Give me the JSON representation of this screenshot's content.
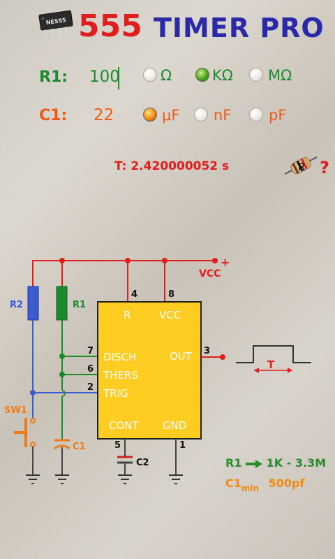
{
  "header": {
    "chip_label": "NE555",
    "title_number": "555",
    "title_text": "TIMER PRO"
  },
  "r1": {
    "label": "R1:",
    "value": "100",
    "units": [
      "Ω",
      "KΩ",
      "MΩ"
    ],
    "selected_unit": "KΩ"
  },
  "c1": {
    "label": "C1:",
    "value": "22",
    "units": [
      "μF",
      "nF",
      "pF"
    ],
    "selected_unit": "μF"
  },
  "result": {
    "period": "T: 2.420000052 s"
  },
  "toolbar": {
    "resistor_icon_letter": "R",
    "help_label": "?"
  },
  "schematic": {
    "vcc_rail": "VCC",
    "plus": "+",
    "r2": "R2",
    "r1": "R1",
    "sw1": "SW1",
    "c1": "C1",
    "c2": "C2",
    "pins": {
      "p4": "4",
      "p8": "8",
      "p7": "7",
      "p6": "6",
      "p2": "2",
      "p3": "3",
      "p5": "5",
      "p1": "1",
      "r": "R",
      "vcc": "VCC",
      "disch": "DISCH",
      "thers": "THERS",
      "trig": "TRIG",
      "out": "OUT",
      "cont": "CONT",
      "gnd": "GND"
    },
    "waveform_label": "T"
  },
  "notes": {
    "r1_range_label": "R1",
    "r1_range": "1K - 3.3M",
    "c1_min_label": "C1",
    "c1_min_sub": "min",
    "c1_min_value": "500pf"
  },
  "colors": {
    "red": "#e01e1e",
    "blue": "#2a2aa8",
    "green": "#1e8a2e",
    "orange": "#ee5a18",
    "chip": "#ffcc22"
  }
}
